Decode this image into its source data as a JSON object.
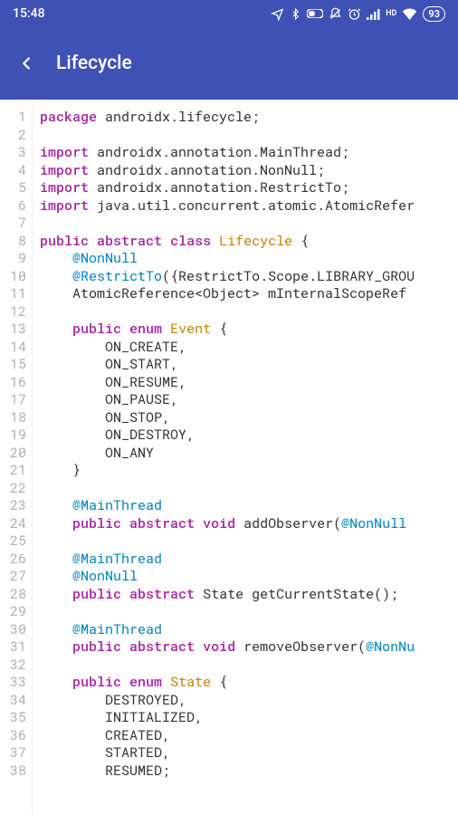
{
  "status": {
    "time": "15:48",
    "battery": "93"
  },
  "header": {
    "title": "Lifecycle"
  },
  "code": {
    "lines": [
      {
        "n": 1,
        "t": [
          [
            "kw",
            "package"
          ],
          [
            "",
            " androidx.lifecycle;"
          ]
        ]
      },
      {
        "n": 2,
        "t": [
          [
            "",
            ""
          ]
        ]
      },
      {
        "n": 3,
        "t": [
          [
            "kw",
            "import"
          ],
          [
            "",
            " androidx.annotation.MainThread;"
          ]
        ]
      },
      {
        "n": 4,
        "t": [
          [
            "kw",
            "import"
          ],
          [
            "",
            " androidx.annotation.NonNull;"
          ]
        ]
      },
      {
        "n": 5,
        "t": [
          [
            "kw",
            "import"
          ],
          [
            "",
            " androidx.annotation.RestrictTo;"
          ]
        ]
      },
      {
        "n": 6,
        "t": [
          [
            "kw",
            "import"
          ],
          [
            "",
            " java.util.concurrent.atomic.AtomicRefer"
          ]
        ]
      },
      {
        "n": 7,
        "t": [
          [
            "",
            ""
          ]
        ]
      },
      {
        "n": 8,
        "t": [
          [
            "kw",
            "public"
          ],
          [
            "",
            " "
          ],
          [
            "kw",
            "abstract"
          ],
          [
            "",
            " "
          ],
          [
            "kw",
            "class"
          ],
          [
            "",
            " "
          ],
          [
            "cls",
            "Lifecycle"
          ],
          [
            "",
            " {"
          ]
        ]
      },
      {
        "n": 9,
        "t": [
          [
            "",
            "    "
          ],
          [
            "ann",
            "@NonNull"
          ]
        ]
      },
      {
        "n": 10,
        "t": [
          [
            "",
            "    "
          ],
          [
            "ann",
            "@RestrictTo"
          ],
          [
            "",
            "({RestrictTo.Scope.LIBRARY_GROU"
          ]
        ]
      },
      {
        "n": 11,
        "t": [
          [
            "",
            "    AtomicReference<Object> mInternalScopeRef"
          ]
        ]
      },
      {
        "n": 12,
        "t": [
          [
            "",
            ""
          ]
        ]
      },
      {
        "n": 13,
        "t": [
          [
            "",
            "    "
          ],
          [
            "kw",
            "public"
          ],
          [
            "",
            " "
          ],
          [
            "kw",
            "enum"
          ],
          [
            "",
            " "
          ],
          [
            "cls",
            "Event"
          ],
          [
            "",
            " {"
          ]
        ]
      },
      {
        "n": 14,
        "t": [
          [
            "",
            "        ON_CREATE,"
          ]
        ]
      },
      {
        "n": 15,
        "t": [
          [
            "",
            "        ON_START,"
          ]
        ]
      },
      {
        "n": 16,
        "t": [
          [
            "",
            "        ON_RESUME,"
          ]
        ]
      },
      {
        "n": 17,
        "t": [
          [
            "",
            "        ON_PAUSE,"
          ]
        ]
      },
      {
        "n": 18,
        "t": [
          [
            "",
            "        ON_STOP,"
          ]
        ]
      },
      {
        "n": 19,
        "t": [
          [
            "",
            "        ON_DESTROY,"
          ]
        ]
      },
      {
        "n": 20,
        "t": [
          [
            "",
            "        ON_ANY"
          ]
        ]
      },
      {
        "n": 21,
        "t": [
          [
            "",
            "    }"
          ]
        ]
      },
      {
        "n": 22,
        "t": [
          [
            "",
            ""
          ]
        ]
      },
      {
        "n": 23,
        "t": [
          [
            "",
            "    "
          ],
          [
            "ann",
            "@MainThread"
          ]
        ]
      },
      {
        "n": 24,
        "t": [
          [
            "",
            "    "
          ],
          [
            "kw",
            "public"
          ],
          [
            "",
            " "
          ],
          [
            "kw",
            "abstract"
          ],
          [
            "",
            " "
          ],
          [
            "kw",
            "void"
          ],
          [
            "",
            " addObserver("
          ],
          [
            "ann",
            "@NonNull"
          ],
          [
            "",
            " "
          ]
        ]
      },
      {
        "n": 25,
        "t": [
          [
            "",
            ""
          ]
        ]
      },
      {
        "n": 26,
        "t": [
          [
            "",
            "    "
          ],
          [
            "ann",
            "@MainThread"
          ]
        ]
      },
      {
        "n": 27,
        "t": [
          [
            "",
            "    "
          ],
          [
            "ann",
            "@NonNull"
          ]
        ]
      },
      {
        "n": 28,
        "t": [
          [
            "",
            "    "
          ],
          [
            "kw",
            "public"
          ],
          [
            "",
            " "
          ],
          [
            "kw",
            "abstract"
          ],
          [
            "",
            " State getCurrentState();"
          ]
        ]
      },
      {
        "n": 29,
        "t": [
          [
            "",
            ""
          ]
        ]
      },
      {
        "n": 30,
        "t": [
          [
            "",
            "    "
          ],
          [
            "ann",
            "@MainThread"
          ]
        ]
      },
      {
        "n": 31,
        "t": [
          [
            "",
            "    "
          ],
          [
            "kw",
            "public"
          ],
          [
            "",
            " "
          ],
          [
            "kw",
            "abstract"
          ],
          [
            "",
            " "
          ],
          [
            "kw",
            "void"
          ],
          [
            "",
            " removeObserver("
          ],
          [
            "ann",
            "@NonNu"
          ]
        ]
      },
      {
        "n": 32,
        "t": [
          [
            "",
            ""
          ]
        ]
      },
      {
        "n": 33,
        "t": [
          [
            "",
            "    "
          ],
          [
            "kw",
            "public"
          ],
          [
            "",
            " "
          ],
          [
            "kw",
            "enum"
          ],
          [
            "",
            " "
          ],
          [
            "cls",
            "State"
          ],
          [
            "",
            " {"
          ]
        ]
      },
      {
        "n": 34,
        "t": [
          [
            "",
            "        DESTROYED,"
          ]
        ]
      },
      {
        "n": 35,
        "t": [
          [
            "",
            "        INITIALIZED,"
          ]
        ]
      },
      {
        "n": 36,
        "t": [
          [
            "",
            "        CREATED,"
          ]
        ]
      },
      {
        "n": 37,
        "t": [
          [
            "",
            "        STARTED,"
          ]
        ]
      },
      {
        "n": 38,
        "t": [
          [
            "",
            "        RESUMED;"
          ]
        ]
      }
    ]
  }
}
